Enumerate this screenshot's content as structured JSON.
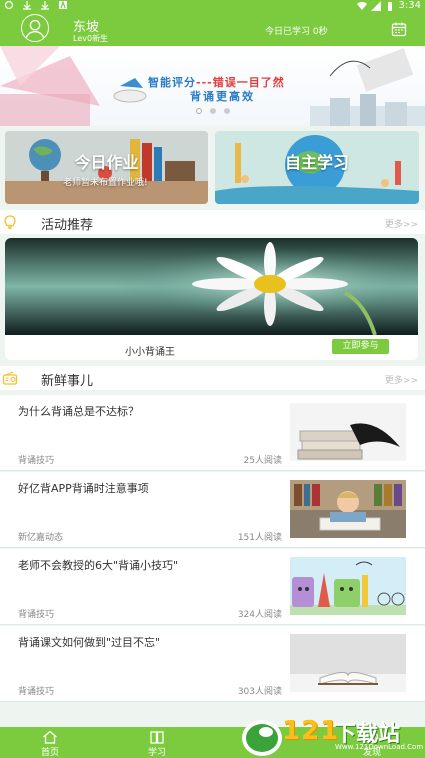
{
  "status_bar": {
    "time": "3:34"
  },
  "header": {
    "user_name": "东坡",
    "user_level": "Lev0新生",
    "study_time": "今日已学习 0秒"
  },
  "banner": {
    "line1_a": "智能评分",
    "line1_b": "---错误一目了然",
    "line2": "背诵更高效"
  },
  "cards": {
    "homework_title": "今日作业",
    "homework_sub": "老师暂未布置作业哦!",
    "self_study_title": "自主学习"
  },
  "sections": {
    "activity_label": "活动推荐",
    "activity_more": "更多>>",
    "news_label": "新鲜事儿",
    "news_more": "更多>>"
  },
  "activity": {
    "name": "小小背诵王",
    "join_label": "立即参与"
  },
  "news": [
    {
      "title": "为什么背诵总是不达标？",
      "category": "背诵技巧",
      "reads": "25人阅读"
    },
    {
      "title": "好亿背APP背诵时注意事项",
      "category": "新亿嘉动态",
      "reads": "151人阅读"
    },
    {
      "title": "老师不会教授的6大\"背诵小技巧\"",
      "category": "背诵技巧",
      "reads": "324人阅读"
    },
    {
      "title": "背诵课文如何做到\"过目不忘\"",
      "category": "背诵技巧",
      "reads": "303人阅读"
    }
  ],
  "bottom_nav": {
    "home": "首页",
    "study": "学习",
    "discover": "发现"
  },
  "watermark": {
    "num": "121",
    "text": "下载站",
    "url": "Www.121DownLoad.Com"
  },
  "colors": {
    "accent": "#7ccb3f",
    "background": "#eef5f0"
  }
}
